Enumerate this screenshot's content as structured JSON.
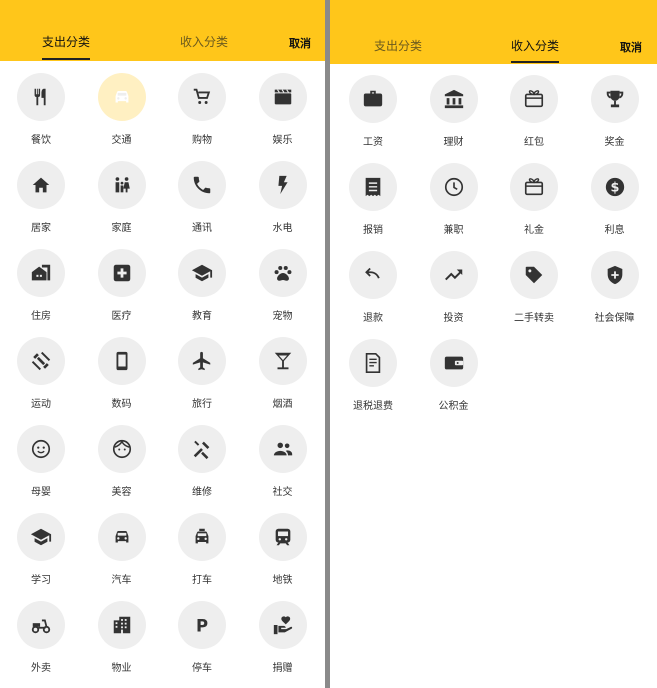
{
  "expense": {
    "tabs": {
      "expense": "支出分类",
      "income": "收入分类"
    },
    "cancel": "取消",
    "items": [
      {
        "label": "餐饮",
        "icon": "restaurant-icon"
      },
      {
        "label": "交通",
        "icon": "car-icon",
        "selected": true
      },
      {
        "label": "购物",
        "icon": "cart-icon"
      },
      {
        "label": "娱乐",
        "icon": "clapperboard-icon"
      },
      {
        "label": "居家",
        "icon": "home-icon"
      },
      {
        "label": "家庭",
        "icon": "family-icon"
      },
      {
        "label": "通讯",
        "icon": "phone-icon"
      },
      {
        "label": "水电",
        "icon": "lightning-icon"
      },
      {
        "label": "住房",
        "icon": "house-building-icon"
      },
      {
        "label": "医疗",
        "icon": "medical-icon"
      },
      {
        "label": "教育",
        "icon": "graduation-cap-icon"
      },
      {
        "label": "宠物",
        "icon": "paw-icon"
      },
      {
        "label": "运动",
        "icon": "dumbbell-icon"
      },
      {
        "label": "数码",
        "icon": "smartphone-icon"
      },
      {
        "label": "旅行",
        "icon": "airplane-icon"
      },
      {
        "label": "烟酒",
        "icon": "cocktail-icon"
      },
      {
        "label": "母婴",
        "icon": "baby-face-icon"
      },
      {
        "label": "美容",
        "icon": "face-icon"
      },
      {
        "label": "维修",
        "icon": "tools-icon"
      },
      {
        "label": "社交",
        "icon": "people-icon"
      },
      {
        "label": "学习",
        "icon": "school-icon"
      },
      {
        "label": "汽车",
        "icon": "car-icon"
      },
      {
        "label": "打车",
        "icon": "taxi-icon"
      },
      {
        "label": "地铁",
        "icon": "subway-icon"
      },
      {
        "label": "外卖",
        "icon": "scooter-icon"
      },
      {
        "label": "物业",
        "icon": "apartment-icon"
      },
      {
        "label": "停车",
        "icon": "parking-icon"
      },
      {
        "label": "捐赠",
        "icon": "donate-heart-icon"
      }
    ]
  },
  "income": {
    "tabs": {
      "expense": "支出分类",
      "income": "收入分类"
    },
    "cancel": "取消",
    "items": [
      {
        "label": "工资",
        "icon": "briefcase-icon"
      },
      {
        "label": "理财",
        "icon": "bank-icon"
      },
      {
        "label": "红包",
        "icon": "red-envelope-icon"
      },
      {
        "label": "奖金",
        "icon": "trophy-icon"
      },
      {
        "label": "报销",
        "icon": "receipt-icon"
      },
      {
        "label": "兼职",
        "icon": "clock-icon"
      },
      {
        "label": "礼金",
        "icon": "gift-card-icon"
      },
      {
        "label": "利息",
        "icon": "dollar-coin-icon"
      },
      {
        "label": "退款",
        "icon": "undo-icon"
      },
      {
        "label": "投资",
        "icon": "trending-up-icon"
      },
      {
        "label": "二手转卖",
        "icon": "tag-icon"
      },
      {
        "label": "社会保障",
        "icon": "shield-plus-icon"
      },
      {
        "label": "退税退费",
        "icon": "tax-document-icon"
      },
      {
        "label": "公积金",
        "icon": "wallet-icon"
      }
    ]
  }
}
